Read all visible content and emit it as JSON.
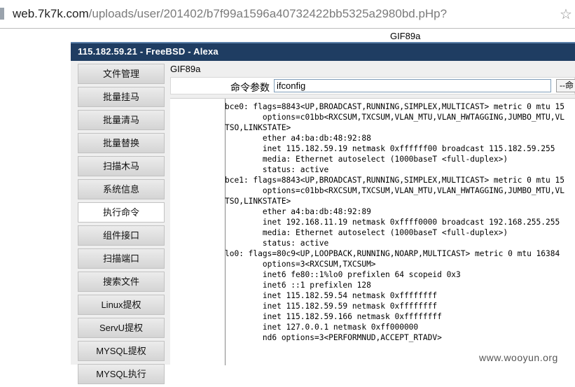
{
  "browser": {
    "url_host": "web.7k7k.com",
    "url_path": "/uploads/user/201402/b7f99a1596a40732422bb5325a2980bd.pHp?"
  },
  "page": {
    "gif_header_top": "GIF89a",
    "title": "115.182.59.21 - FreeBSD - Alexa",
    "gif_header_inner": "GIF89a",
    "sidebar": {
      "items": [
        {
          "label": "文件管理",
          "active": false
        },
        {
          "label": "批量挂马",
          "active": false
        },
        {
          "label": "批量清马",
          "active": false
        },
        {
          "label": "批量替换",
          "active": false
        },
        {
          "label": "扫描木马",
          "active": false
        },
        {
          "label": "系统信息",
          "active": false
        },
        {
          "label": "执行命令",
          "active": true
        },
        {
          "label": "组件接口",
          "active": false
        },
        {
          "label": "扫描端口",
          "active": false
        },
        {
          "label": "搜索文件",
          "active": false
        },
        {
          "label": "Linux提权",
          "active": false
        },
        {
          "label": "ServU提权",
          "active": false
        },
        {
          "label": "MYSQL提权",
          "active": false
        },
        {
          "label": "MYSQL执行",
          "active": false
        }
      ]
    },
    "command": {
      "label": "命令参数",
      "value": "ifconfig",
      "button_label": "--命"
    },
    "output": "bce0: flags=8843<UP,BROADCAST,RUNNING,SIMPLEX,MULTICAST> metric 0 mtu 15\n        options=c01bb<RXCSUM,TXCSUM,VLAN_MTU,VLAN_HWTAGGING,JUMBO_MTU,VL\nTSO,LINKSTATE>\n        ether a4:ba:db:48:92:88\n        inet 115.182.59.19 netmask 0xffffff00 broadcast 115.182.59.255\n        media: Ethernet autoselect (1000baseT <full-duplex>)\n        status: active\nbce1: flags=8843<UP,BROADCAST,RUNNING,SIMPLEX,MULTICAST> metric 0 mtu 15\n        options=c01bb<RXCSUM,TXCSUM,VLAN_MTU,VLAN_HWTAGGING,JUMBO_MTU,VL\nTSO,LINKSTATE>\n        ether a4:ba:db:48:92:89\n        inet 192.168.11.19 netmask 0xffff0000 broadcast 192.168.255.255\n        media: Ethernet autoselect (1000baseT <full-duplex>)\n        status: active\nlo0: flags=80c9<UP,LOOPBACK,RUNNING,NOARP,MULTICAST> metric 0 mtu 16384\n        options=3<RXCSUM,TXCSUM>\n        inet6 fe80::1%lo0 prefixlen 64 scopeid 0x3\n        inet6 ::1 prefixlen 128\n        inet 115.182.59.54 netmask 0xffffffff\n        inet 115.182.59.59 netmask 0xffffffff\n        inet 115.182.59.166 netmask 0xffffffff\n        inet 127.0.0.1 netmask 0xff000000\n        nd6 options=3<PERFORMNUD,ACCEPT_RTADV>"
  },
  "watermark": "www.wooyun.org",
  "colors": {
    "titlebar": "#1f3d62",
    "page_bg": "#efefef"
  }
}
